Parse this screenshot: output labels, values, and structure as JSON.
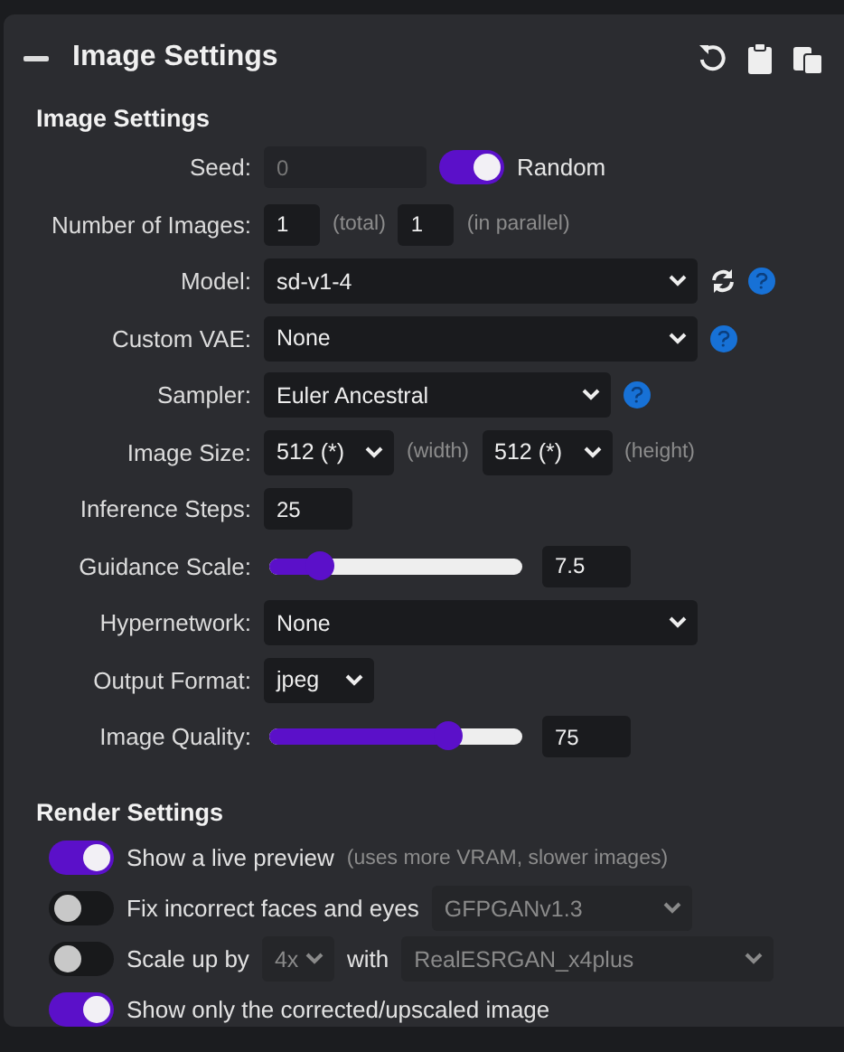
{
  "panel": {
    "title": "Image Settings"
  },
  "image_settings": {
    "heading": "Image Settings",
    "rows": [
      {
        "label": "Seed:",
        "controls": [
          {
            "kind": "field",
            "value": "0",
            "disabled": true
          },
          {
            "kind": "toggle",
            "on": true,
            "label": "Random"
          }
        ]
      },
      {
        "label": "Number of Images:",
        "controls": [
          {
            "kind": "field",
            "value": "1"
          },
          {
            "kind": "hint",
            "text": "(total)"
          },
          {
            "kind": "field",
            "value": "1"
          },
          {
            "kind": "hint",
            "text": "(in parallel)"
          }
        ]
      },
      {
        "label": "Model:",
        "controls": [
          {
            "kind": "select",
            "value": "sd-v1-4"
          },
          {
            "kind": "refresh"
          },
          {
            "kind": "help"
          }
        ]
      },
      {
        "label": "Custom VAE:",
        "controls": [
          {
            "kind": "select",
            "value": "None"
          },
          {
            "kind": "help"
          }
        ]
      },
      {
        "label": "Sampler:",
        "controls": [
          {
            "kind": "select",
            "value": "Euler Ancestral"
          },
          {
            "kind": "help"
          }
        ]
      },
      {
        "label": "Image Size:",
        "controls": [
          {
            "kind": "select",
            "value": "512 (*)"
          },
          {
            "kind": "hint",
            "text": "(width)"
          },
          {
            "kind": "select",
            "value": "512 (*)"
          },
          {
            "kind": "hint",
            "text": "(height)"
          }
        ]
      },
      {
        "label": "Inference Steps:",
        "controls": [
          {
            "kind": "field",
            "value": "25"
          }
        ]
      },
      {
        "label": "Guidance Scale:",
        "controls": [
          {
            "kind": "slider",
            "level": 0.2
          },
          {
            "kind": "field",
            "value": "7.5"
          }
        ]
      },
      {
        "label": "Hypernetwork:",
        "controls": [
          {
            "kind": "select",
            "value": "None"
          }
        ]
      },
      {
        "label": "Output Format:",
        "controls": [
          {
            "kind": "select",
            "value": "jpeg"
          }
        ]
      },
      {
        "label": "Image Quality:",
        "controls": [
          {
            "kind": "slider",
            "level": 0.71
          },
          {
            "kind": "field",
            "value": "75"
          }
        ]
      }
    ]
  },
  "render_settings": {
    "heading": "Render Settings",
    "items": [
      {
        "on": true,
        "parts": [
          {
            "kind": "text",
            "text": "Show a live preview"
          },
          {
            "kind": "hint",
            "text": "(uses more VRAM, slower images)"
          }
        ]
      },
      {
        "on": false,
        "parts": [
          {
            "kind": "text",
            "text": "Fix incorrect faces and eyes"
          },
          {
            "kind": "select",
            "value": "GFPGANv1.3",
            "disabled": true
          }
        ]
      },
      {
        "on": false,
        "parts": [
          {
            "kind": "text",
            "text": "Scale up by"
          },
          {
            "kind": "select",
            "value": "4x",
            "disabled": true
          },
          {
            "kind": "text",
            "text": "with"
          },
          {
            "kind": "select",
            "value": "RealESRGAN_x4plus",
            "disabled": true
          }
        ]
      },
      {
        "on": true,
        "parts": [
          {
            "kind": "text",
            "text": "Show only the corrected/upscaled image"
          }
        ]
      }
    ]
  }
}
